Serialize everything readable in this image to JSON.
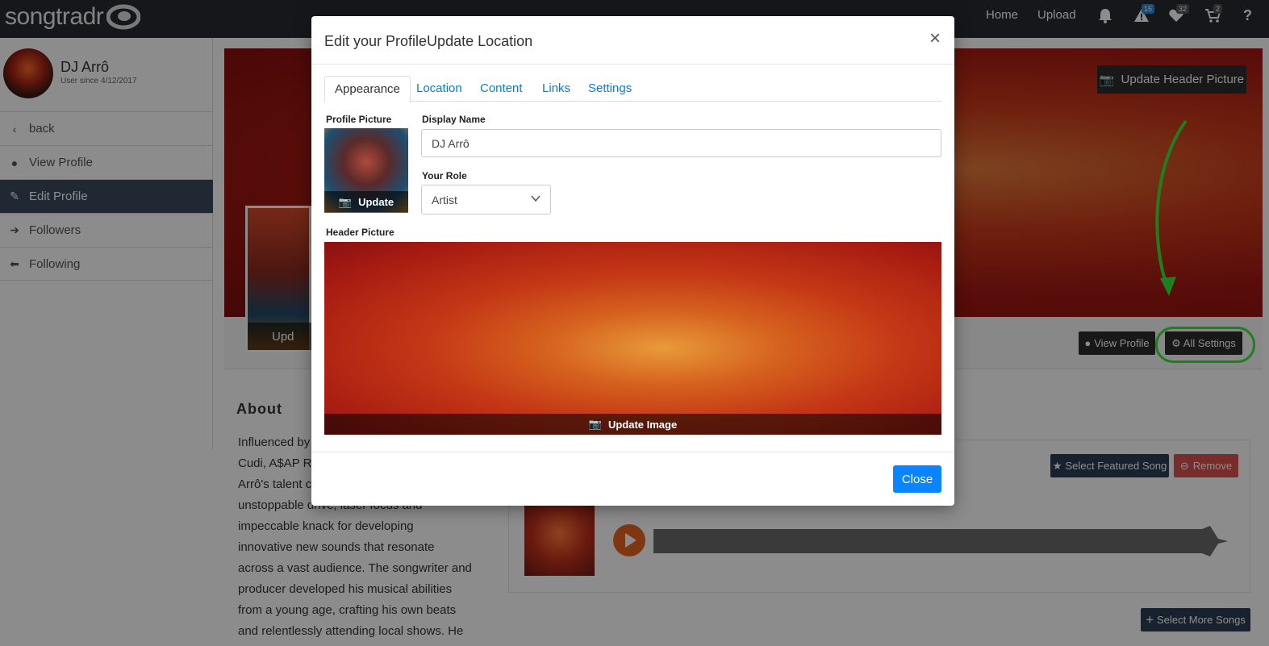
{
  "brand": {
    "logo_text": "songtradr"
  },
  "topnav": {
    "home": "Home",
    "upload": "Upload",
    "alerts_count": "15",
    "favorites_count": "32",
    "cart_count": "2",
    "help": "?"
  },
  "sidebar": {
    "user_name": "DJ Arrô",
    "user_since": "User since 4/12/2017",
    "items": [
      {
        "label": "back",
        "icon": "chevron-left-icon"
      },
      {
        "label": "View Profile",
        "icon": "user-icon"
      },
      {
        "label": "Edit Profile",
        "icon": "pencil-icon"
      },
      {
        "label": "Followers",
        "icon": "arrow-right-icon"
      },
      {
        "label": "Following",
        "icon": "arrow-left-icon"
      }
    ]
  },
  "profile": {
    "update_header_btn": "Update Header Picture",
    "update_pic_btn": "Upd",
    "view_profile_btn": "View Profile",
    "all_settings_btn": "All Settings",
    "about_title": "About",
    "about_lines": [
      "Influenced by",
      "Cudi, A$AP Ro",
      "Arrô's talent c",
      "unstoppable drive, laser focus and",
      "impeccable knack for developing",
      "innovative new sounds that resonate",
      "across a vast audience. The songwriter and",
      "producer developed his musical abilities",
      "from a young age, crafting his own beats",
      "and relentlessly attending local shows. He"
    ]
  },
  "songs": {
    "select_featured": "Select Featured Song",
    "remove": "Remove",
    "select_more": "Select More Songs"
  },
  "modal": {
    "title": "Edit your ProfileUpdate Location",
    "close_x": "×",
    "tabs": [
      "Appearance",
      "Location",
      "Content",
      "Links",
      "Settings"
    ],
    "active_tab": "Appearance",
    "profile_picture_label": "Profile Picture",
    "update_label": "Update",
    "display_name_label": "Display Name",
    "display_name_value": "DJ Arrô",
    "role_label": "Your Role",
    "role_value": "Artist",
    "header_picture_label": "Header Picture",
    "update_image_label": "Update Image",
    "close_btn": "Close"
  },
  "colors": {
    "accent": "#0b84ff",
    "highlight": "#39e639",
    "navbar": "#272b31"
  }
}
